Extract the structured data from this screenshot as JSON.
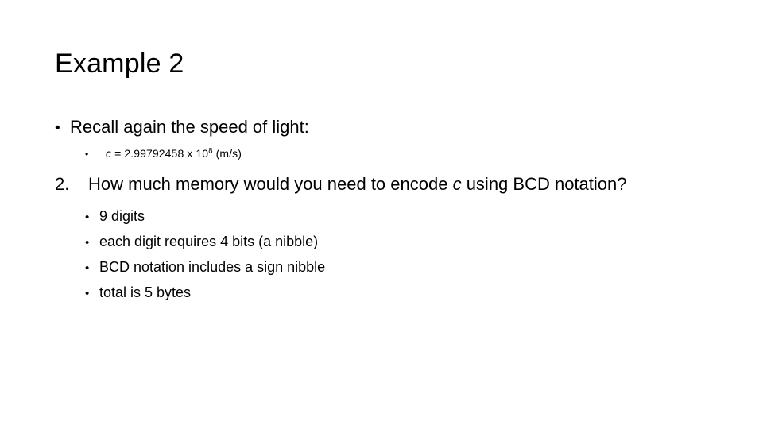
{
  "slide": {
    "title": "Example 2",
    "background_color": "#ffffff",
    "text_color": "#000000",
    "bullet_glyph": "•",
    "blocks": {
      "recall_bullet": {
        "marker": "•",
        "text": "Recall again the speed of light:"
      },
      "speed_of_light": {
        "marker": "•",
        "variable": "c",
        "equals": " = 2.99792458 x 10",
        "exponent": "8",
        "units": " (m/s)"
      },
      "question": {
        "marker": "2.",
        "text_before_var": "How much memory would you need to encode ",
        "variable": "c",
        "text_after_var": " using BCD notation?"
      },
      "answers": [
        {
          "marker": "•",
          "text": "9 digits"
        },
        {
          "marker": "•",
          "text": "each digit requires 4 bits (a nibble)"
        },
        {
          "marker": "•",
          "text": "BCD notation includes a sign nibble"
        },
        {
          "marker": "•",
          "text": "total is 5 bytes"
        }
      ]
    }
  }
}
